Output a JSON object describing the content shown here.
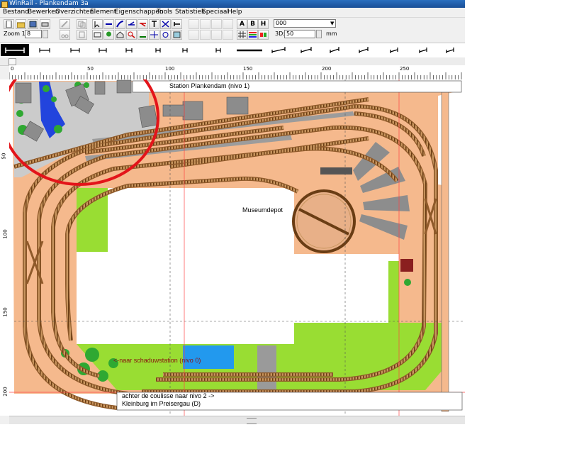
{
  "window": {
    "title": "WinRail - Plankendam 3a"
  },
  "menu": [
    "Bestand",
    "Bewerken",
    "Overzichten",
    "Element",
    "Eigenschappen",
    "Tools",
    "Statistiek",
    "Speciaal",
    "Help"
  ],
  "toolbar": {
    "zoom_label": "Zoom 1:",
    "zoom_value": "8",
    "layer_value": "000",
    "text_buttons": [
      "A",
      "B",
      "H"
    ],
    "view3d_label": "3D:",
    "view3d_value": "50",
    "unit_label": "mm"
  },
  "ruler": {
    "top_labels": [
      "0",
      "50",
      "100",
      "150",
      "200",
      "250"
    ],
    "left_labels": [
      "50",
      "100",
      "150",
      "200"
    ]
  },
  "layout": {
    "labels": {
      "station": "Station Plankendam (nivo 1)",
      "depot": "Museumdepot",
      "shadow": "<-naar schaduwstation (nivo 0)",
      "coulisse": "achter de coulisse  naar nivo 2 ->",
      "kleinburg": "Kleinburg im Preisergau (D)"
    }
  },
  "colors": {
    "title_bar": "#1a4f96",
    "baseboard": "#f5b98d",
    "grass": "#99dd33",
    "water": "#2299ee",
    "road": "#c8c8c8",
    "track_bed": "#8f5a2a",
    "annotation_circle": "#e3141a"
  }
}
